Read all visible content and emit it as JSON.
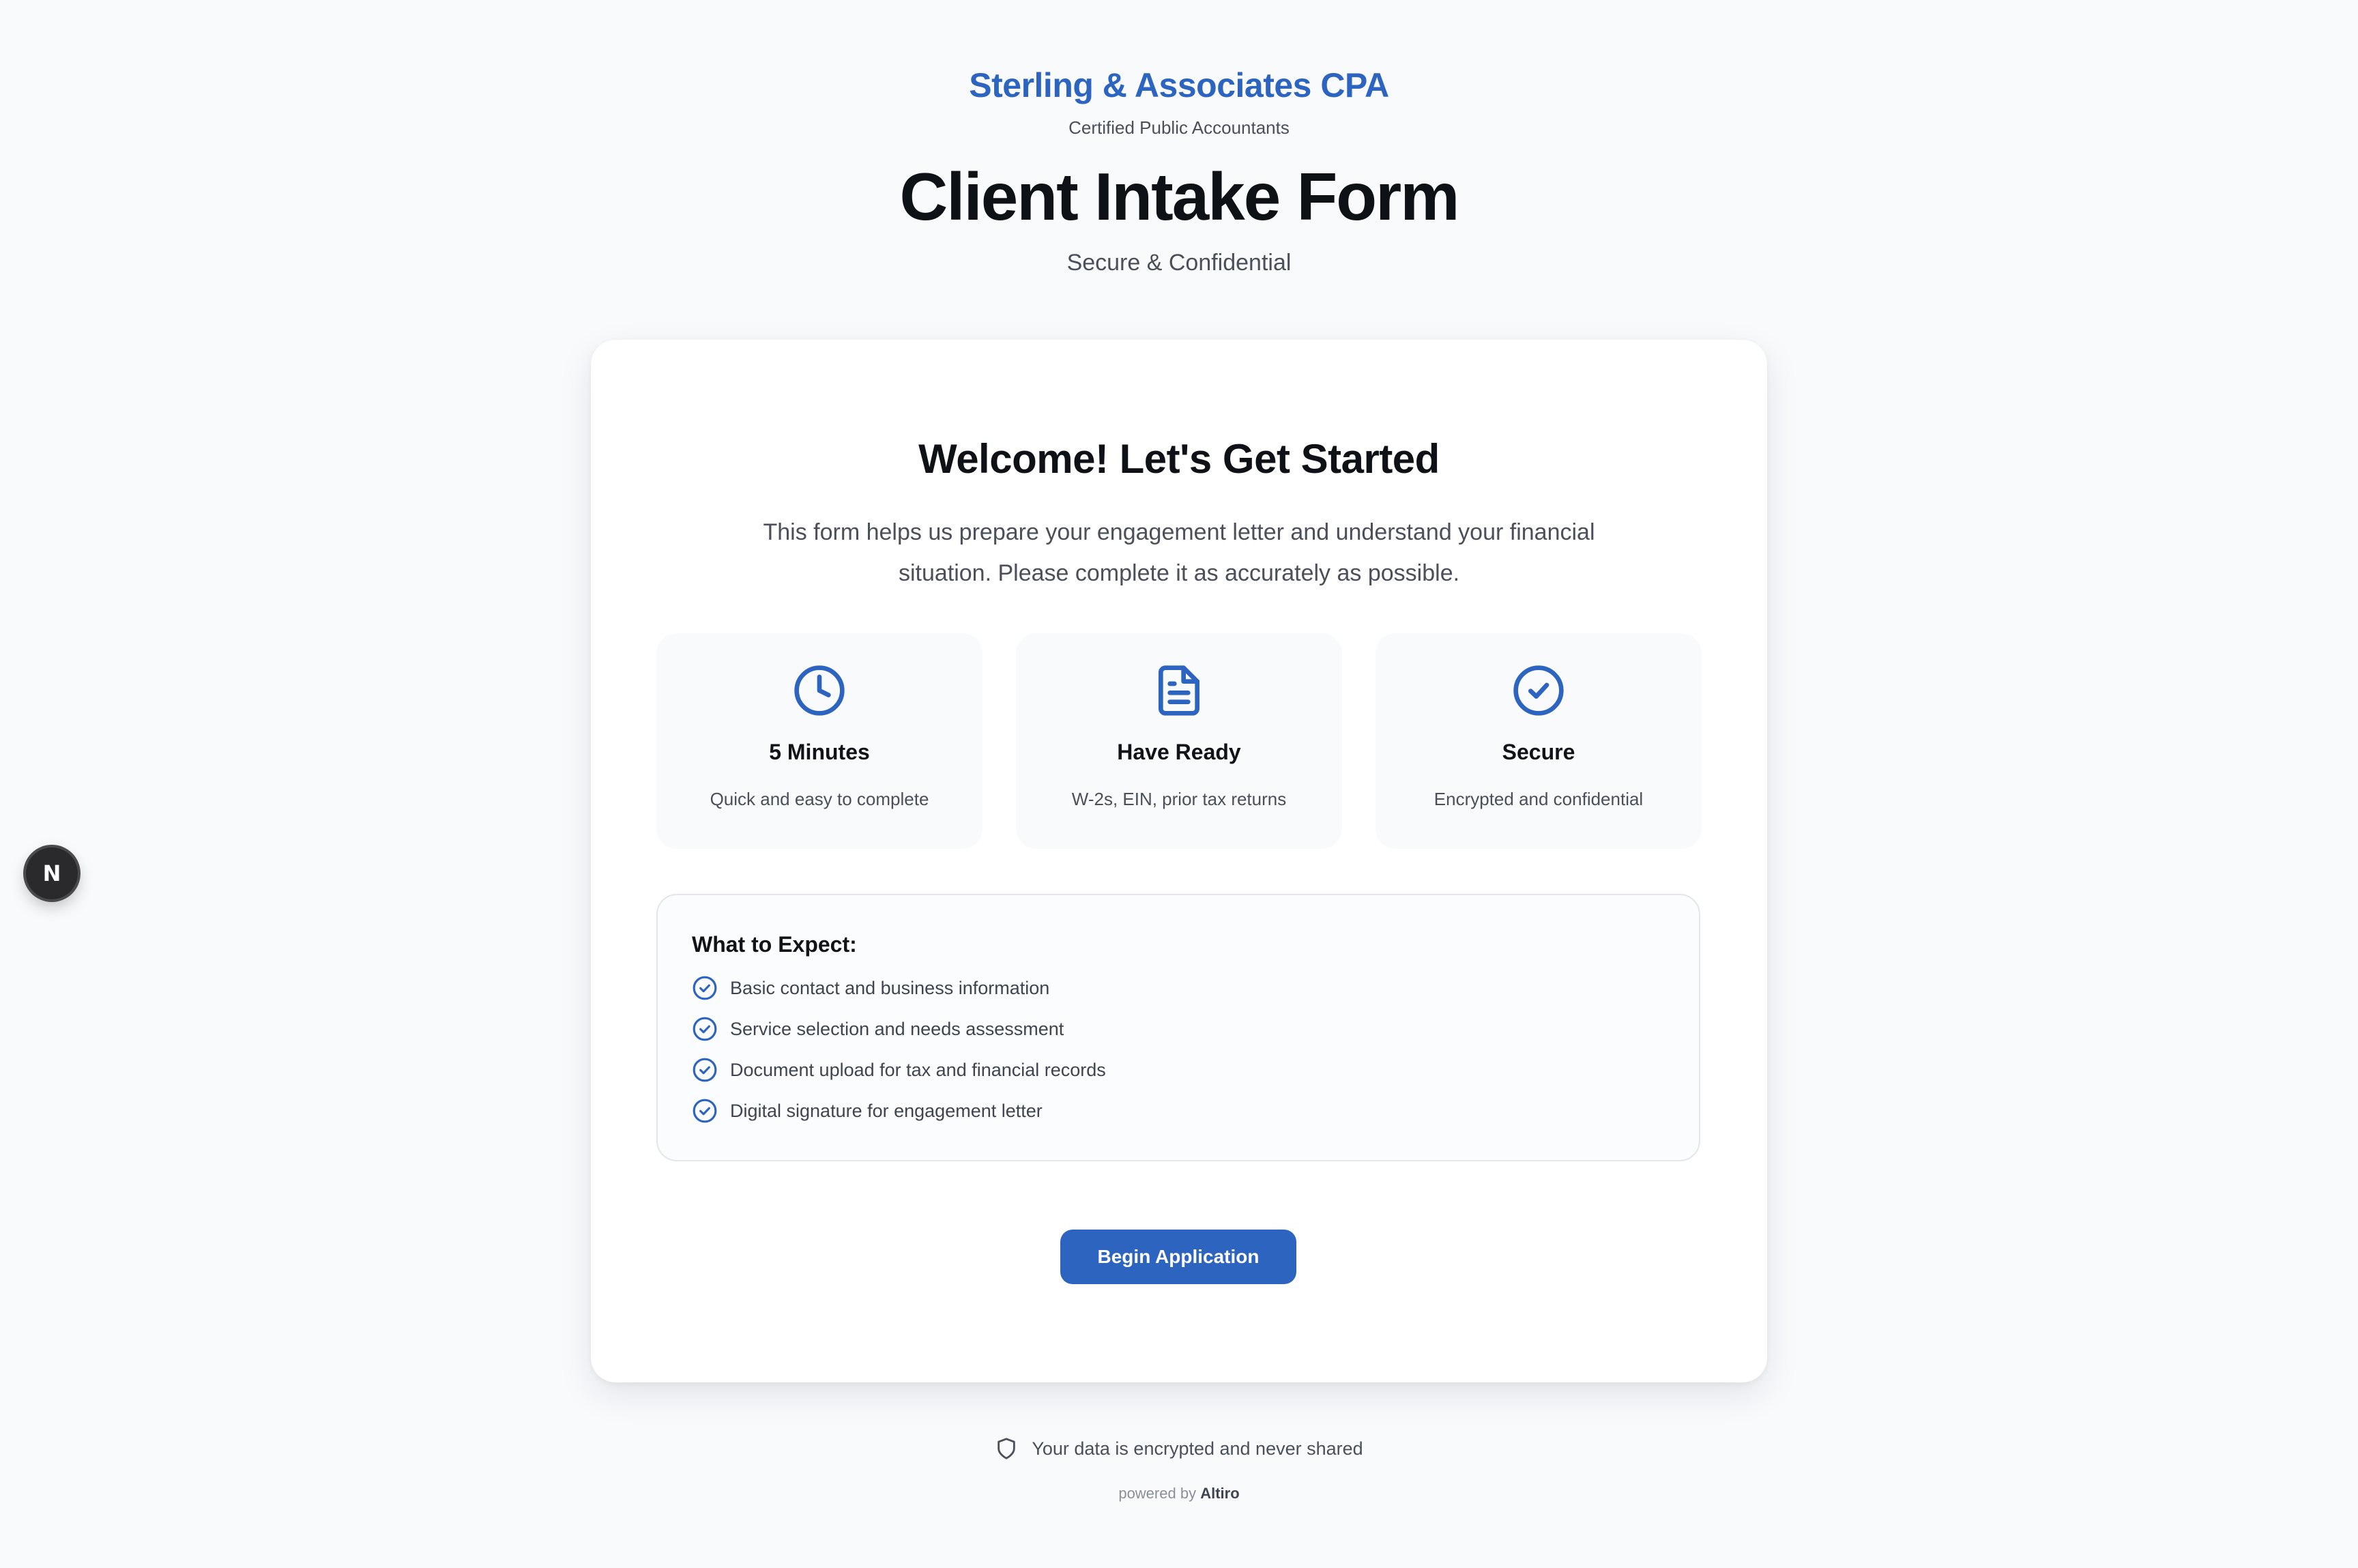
{
  "header": {
    "brand": "Sterling & Associates CPA",
    "brand_subtitle": "Certified Public Accountants",
    "title": "Client Intake Form",
    "subtitle": "Secure & Confidential"
  },
  "card": {
    "welcome": "Welcome! Let's Get Started",
    "intro": "This form helps us prepare your engagement letter and understand your financial situation. Please complete it as accurately as possible.",
    "features": [
      {
        "icon": "clock-icon",
        "title": "5 Minutes",
        "description": "Quick and easy to complete"
      },
      {
        "icon": "document-icon",
        "title": "Have Ready",
        "description": "W-2s, EIN, prior tax returns"
      },
      {
        "icon": "check-circle-icon",
        "title": "Secure",
        "description": "Encrypted and confidential"
      }
    ],
    "expect": {
      "title": "What to Expect:",
      "items": [
        "Basic contact and business information",
        "Service selection and needs assessment",
        "Document upload for tax and financial records",
        "Digital signature for engagement letter"
      ]
    },
    "begin_button": "Begin Application"
  },
  "footer": {
    "secure_note": "Your data is encrypted and never shared",
    "powered_by": "powered by",
    "powered_brand": "Altiro"
  },
  "dev_badge": {
    "label": "N"
  },
  "colors": {
    "accent": "#2c64c0",
    "background": "#f9fafc",
    "card": "#ffffff",
    "text": "#111318",
    "muted_text": "#4a4f5a"
  }
}
